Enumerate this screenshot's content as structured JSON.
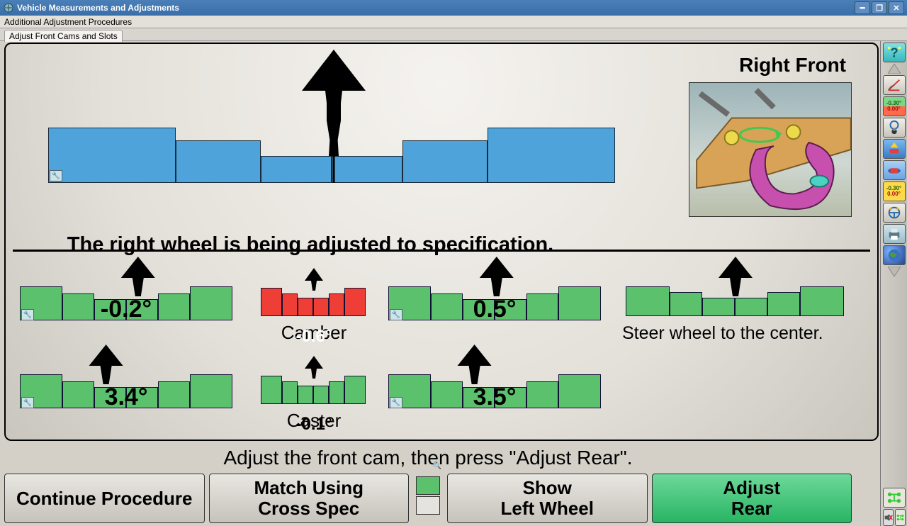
{
  "titlebar": {
    "title": "Vehicle Measurements and Adjustments",
    "menu": "Additional Adjustment Procedures",
    "tab": "Adjust Front Cams and Slots"
  },
  "top": {
    "wheel_label": "Right Front",
    "message": "The right wheel is being adjusted to specification."
  },
  "gauges": {
    "camber_left_value": "-0.2°",
    "camber_center_value": "-0.6°",
    "camber_right_value": "0.5°",
    "camber_label": "Camber",
    "caster_left_value": "3.4°",
    "caster_center_value": "-0.1°",
    "caster_right_value": "3.5°",
    "caster_label": "Caster",
    "steer_message": "Steer wheel to the center."
  },
  "instruction": "Adjust the front cam, then press \"Adjust Rear\".",
  "buttons": {
    "b1": "Continue Procedure",
    "b2_l1": "Match Using",
    "b2_l2": "Cross Spec",
    "b3_l1": "Show",
    "b3_l2": "Left Wheel",
    "b4_l1": "Adjust",
    "b4_l2": "Rear"
  },
  "side": {
    "values1": "-0.30°",
    "values2": "0.00°"
  }
}
